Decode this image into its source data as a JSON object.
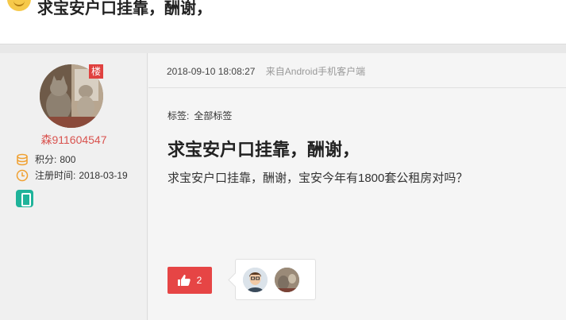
{
  "header": {
    "title": "求宝安户口挂靠，酬谢，"
  },
  "author": {
    "floor_badge": "楼",
    "username": "森911604547",
    "points_label": "积分:",
    "points_value": "800",
    "register_label": "注册时间:",
    "register_value": "2018-03-19",
    "icons": [
      "coins-icon",
      "clock-icon",
      "phone-icon"
    ]
  },
  "post": {
    "datetime": "2018-09-10 18:08:27",
    "source": "来自Android手机客户端",
    "tags_label": "标签:",
    "tag": "全部标签",
    "title": "求宝安户口挂靠，酬谢，",
    "body": "求宝安户口挂靠，酬谢，宝安今年有1800套公租房对吗？",
    "like_count": "2"
  },
  "colors": {
    "accent_red": "#e64545",
    "username_red": "#d9534f",
    "mobile_teal": "#1fb39a",
    "icon_orange": "#f0a030"
  }
}
